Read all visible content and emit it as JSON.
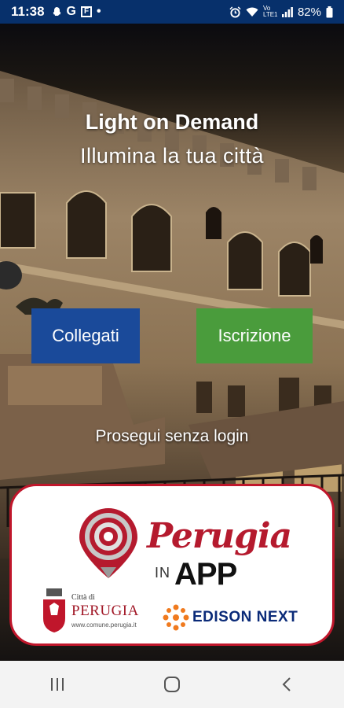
{
  "status_bar": {
    "time": "11:38",
    "left_icons": [
      "snapchat-icon",
      "google-icon",
      "flipboard-icon"
    ],
    "dot": "•",
    "network": "Vo LTE1",
    "battery": "82%"
  },
  "hero": {
    "title": "Light on Demand",
    "subtitle": "Illumina la tua città"
  },
  "actions": {
    "login_label": "Collegati",
    "signup_label": "Iscrizione",
    "skip_label": "Prosegui senza login"
  },
  "logo": {
    "perugia_label": "Perugia",
    "in_label": "IN",
    "app_label": "APP",
    "comune_citta": "Città di",
    "comune_name": "PERUGIA",
    "comune_url": "www.comune.perugia.it",
    "edison_label": "EDISON NEXT"
  },
  "colors": {
    "status_bg": "#07306b",
    "login_bg": "#1a4a9a",
    "signup_bg": "#4a9c3c",
    "brand_red": "#b51a2e",
    "edison_blue": "#0a2a78",
    "edison_orange": "#f07a1e"
  }
}
